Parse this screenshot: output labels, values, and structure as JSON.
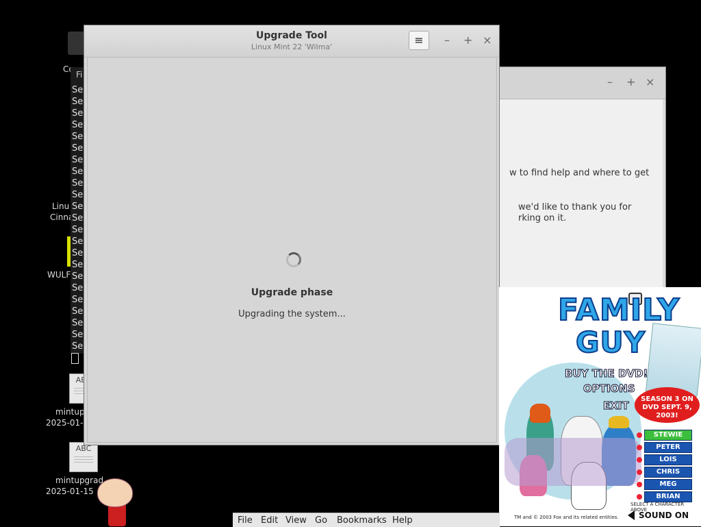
{
  "desktop": {
    "icon_computer_label": "Co",
    "icon_linux_label_1": "Linu",
    "icon_linux_label_2": "Cinna",
    "icon_wulf_label": "WULF",
    "file1": {
      "badge": "ABC",
      "name": "mintupg",
      "date": "2025-01-"
    },
    "file2": {
      "badge": "ABC",
      "name": "mintupgrad",
      "date": "2025-01-15"
    }
  },
  "bg_window": {
    "title_fragment": "Fi",
    "line_text": "Se",
    "line_count": 23
  },
  "second_window": {
    "text1": "w to find help and where to get",
    "text2": "we'd like to thank you for",
    "text3": "rking on it."
  },
  "main_window": {
    "title": "Upgrade Tool",
    "subtitle": "Linux Mint 22 'Wilma'",
    "menu_icon": "≡",
    "min": "–",
    "max": "+",
    "close": "×",
    "phase_title": "Upgrade phase",
    "phase_status": "Upgrading the system..."
  },
  "family_guy": {
    "logo_line1": "FAMILY",
    "logo_line2": "GUY",
    "menu": [
      "BUY THE DVD!",
      "OPTIONS",
      "EXIT"
    ],
    "season": "SEASON 3 ON DVD SEPT. 9, 2003!",
    "characters": [
      "STEWIE",
      "PETER",
      "LOIS",
      "CHRIS",
      "MEG",
      "BRIAN"
    ],
    "select_text": "SELECT A CHARACTER ABOVE",
    "copyright": "TM and © 2003 Fox and its related entities.",
    "sound": "SOUND ON",
    "colors": {
      "logo": "#2fa6e8",
      "season": "#e01e1e",
      "button": "#1a55b0",
      "active_button": "#3cbf3c"
    }
  },
  "file_manager_menu": [
    "File",
    "Edit",
    "View",
    "Go",
    "Bookmarks",
    "Help"
  ]
}
